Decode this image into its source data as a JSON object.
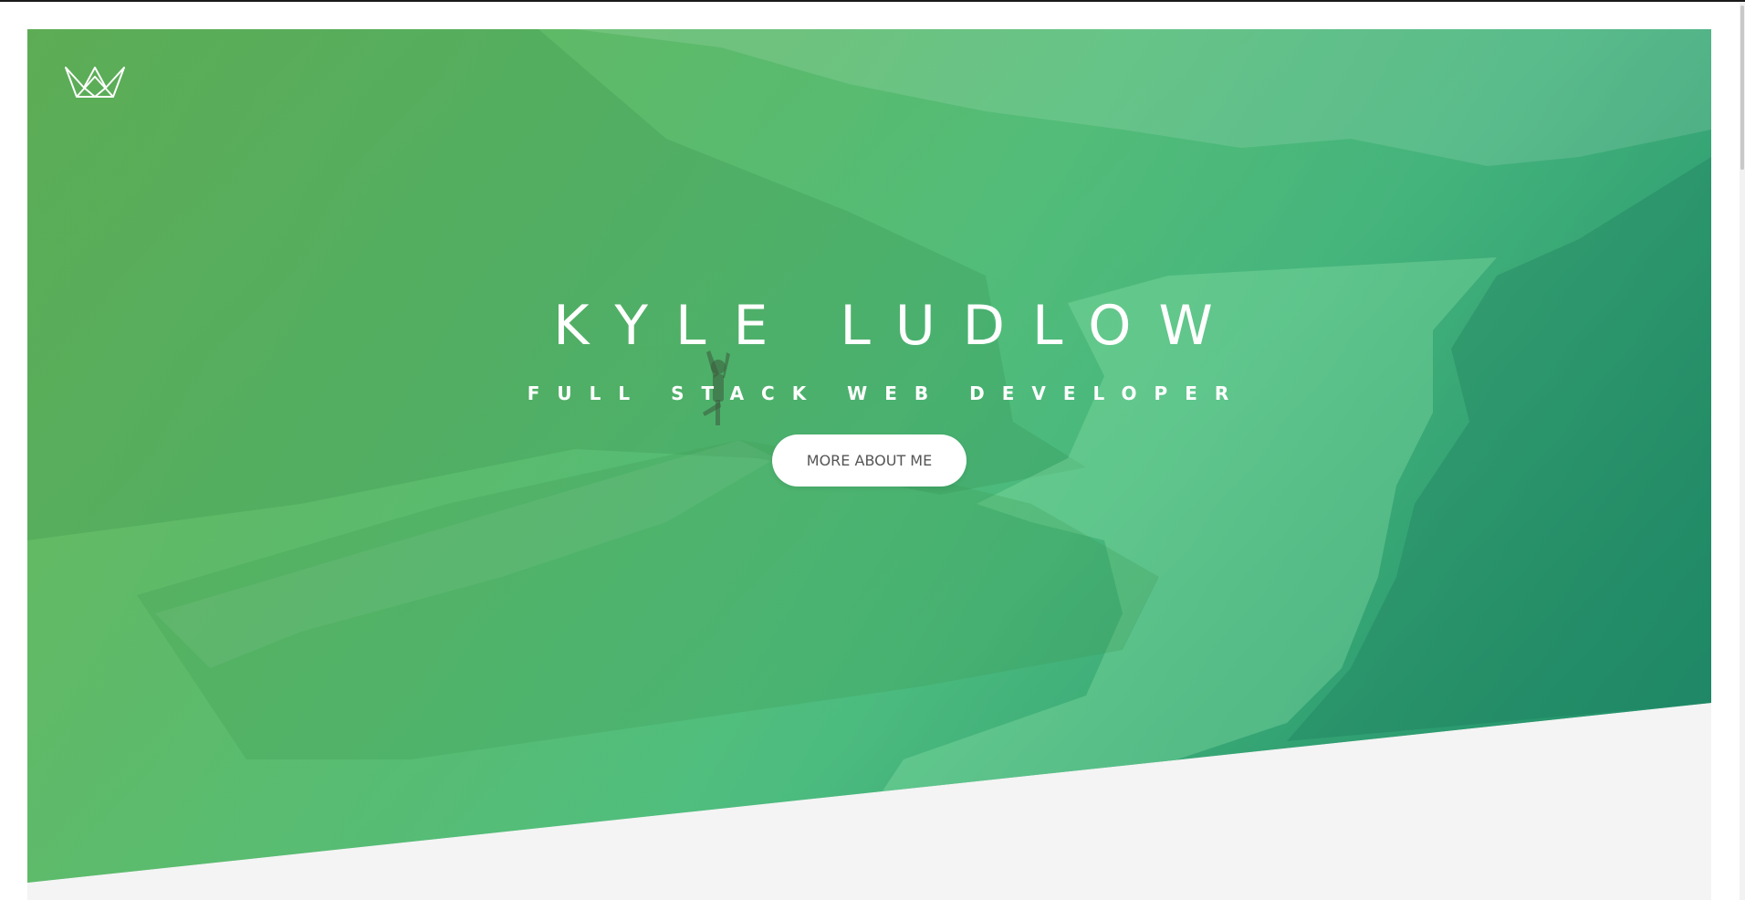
{
  "hero": {
    "title": "KYLE LUDLOW",
    "subtitle": "FULL STACK WEB DEVELOPER",
    "cta_label": "MORE ABOUT ME",
    "logo_icon": "crown-icon"
  },
  "colors": {
    "gradient_start": "#64b25c",
    "gradient_end": "#1f8a6c",
    "button_bg": "#ffffff",
    "button_text": "#555555",
    "section_bg": "#f4f4f4"
  }
}
